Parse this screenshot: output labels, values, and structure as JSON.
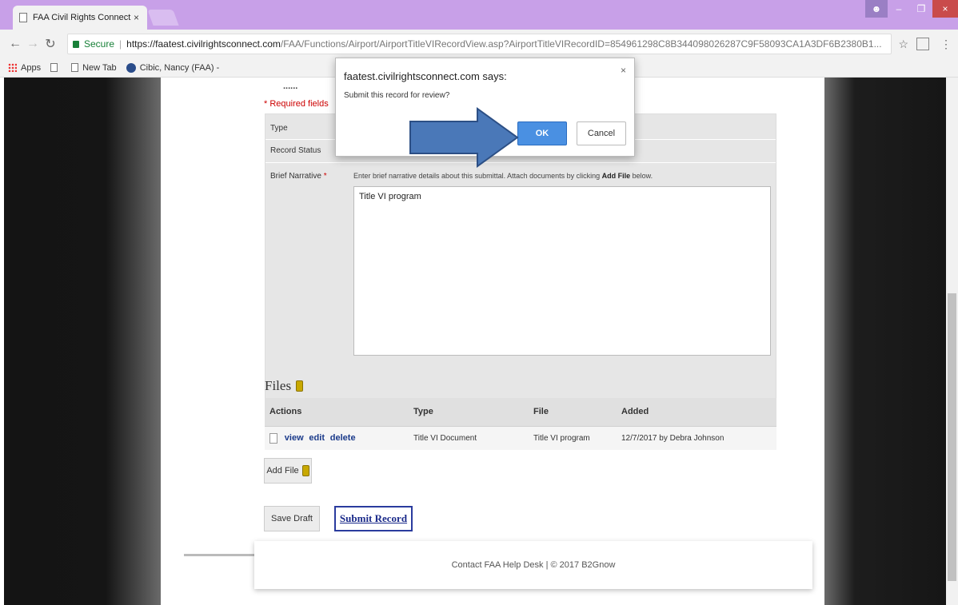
{
  "browser": {
    "tab_title": "FAA Civil Rights Connect",
    "tab_close": "×",
    "secure_label": "Secure",
    "url_host": "https://faatest.civilrightsconnect.com",
    "url_path": "/FAA/Functions/Airport/AirportTitleVIRecordView.asp?AirportTitleVIRecordID=854961298C8B344098026287C9F58093CA1A3DF6B2380B1...",
    "bookmarks": [
      "Apps",
      "New Tab",
      "Cibic, Nancy (FAA) -"
    ]
  },
  "page": {
    "partial_heading": "......",
    "required_fields": "* Required fields",
    "form": {
      "type_label": "Type",
      "status_label": "Record Status",
      "narrative_label": "Brief Narrative",
      "narrative_required": "*",
      "narrative_help_pre": "Enter brief narrative details about this submittal. Attach documents by clicking ",
      "narrative_help_bold": "Add File",
      "narrative_help_post": " below.",
      "narrative_value": "Title VI program"
    },
    "files": {
      "title": "Files",
      "columns": [
        "Actions",
        "Type",
        "File",
        "Added"
      ],
      "rows": [
        {
          "actions": [
            "view",
            "edit",
            "delete"
          ],
          "type": "Title VI Document",
          "file": "Title VI program",
          "added": "12/7/2017 by Debra Johnson"
        }
      ]
    },
    "add_file_label": "Add File",
    "save_draft_label": "Save Draft",
    "submit_label": "Submit Record",
    "footer": "Contact FAA Help Desk | © 2017 B2Gnow"
  },
  "dialog": {
    "title": "faatest.civilrightsconnect.com says:",
    "message": "Submit this record for review?",
    "ok_label": "OK",
    "cancel_label": "Cancel",
    "close": "×"
  },
  "colors": {
    "title_bar": "#c8a0e8",
    "ok_button": "#4a90e2",
    "arrow": "#4a78b8",
    "submit_border": "#2a3b9e"
  },
  "icons": [
    "document-icon",
    "apps-icon",
    "globe-icon",
    "star-icon",
    "extension-icon",
    "menu-icon",
    "paperclip-icon",
    "close-icon",
    "arrow-pointer"
  ]
}
